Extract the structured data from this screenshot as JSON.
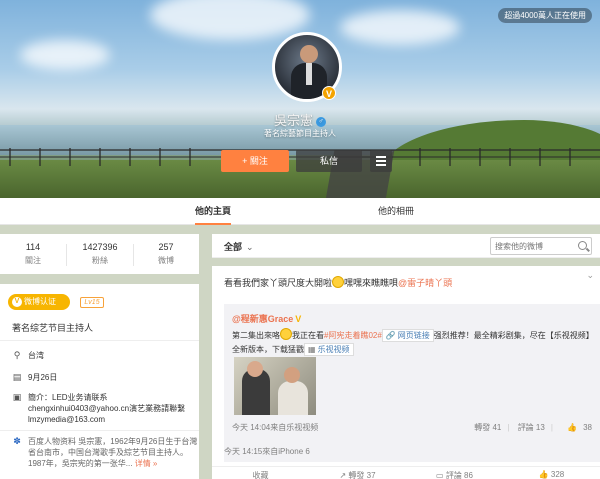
{
  "header": {
    "users_badge": "超過4000萬人正在使用",
    "name": "吳宗憲",
    "description": "著名綜藝節目主持人",
    "follow_label": "+ 關注",
    "message_label": "私信"
  },
  "nav": {
    "tabs": [
      {
        "label": "他的主頁"
      },
      {
        "label": "他的相冊"
      }
    ]
  },
  "stats": [
    {
      "value": "114",
      "label": "關注"
    },
    {
      "value": "1427396",
      "label": "粉絲"
    },
    {
      "value": "257",
      "label": "微博"
    }
  ],
  "info": {
    "verify_label": "微博认证",
    "level": "Lv15",
    "title": "著名综艺节目主持人",
    "location": "台湾",
    "birthday": "9月26日",
    "bio": "簡介：LED业务请联系 chengxinhui0403@yahoo.cn演艺業務請聯繫 lmzymedia@163.com",
    "baike": "百度人物资料 吳宗憲，1962年9月26日生于台灣省台南市，中国台灣歌手及綜艺节目主持人。1987年，吳宗宪的第一张华...",
    "baike_more": "详情 »"
  },
  "feed": {
    "filter_label": "全部",
    "search_placeholder": "搜索他的微博",
    "post_text_1": "看看我們家丫頭尺度大開啦",
    "post_text_2": "嘿嘿來瞧瞧唄",
    "post_mention": "@雷子晴丫頭",
    "repost_author": "@程新惠Grace",
    "repost_text_1": "第二集出來咯",
    "repost_text_2": "我正在看",
    "repost_tag": "#阿宪走着瞧02#",
    "chip_web": "网页链接",
    "repost_text_3": "强烈推荐！最全精彩剧集，尽在【乐视视频】全新版本，下载猛戳",
    "chip_video": "乐视视频",
    "repost_meta": "今天 14:04来自乐视视频",
    "repost_forward": "轉發 41",
    "repost_comment": "評論 13",
    "repost_like": "38",
    "post_meta": "今天 14:15來自iPhone 6",
    "actions": [
      "收藏",
      "轉發 37",
      "評論 86",
      "328"
    ]
  },
  "colors": {
    "accent": "#ff8140",
    "link": "#eb7350",
    "verified": "#f7b500"
  }
}
